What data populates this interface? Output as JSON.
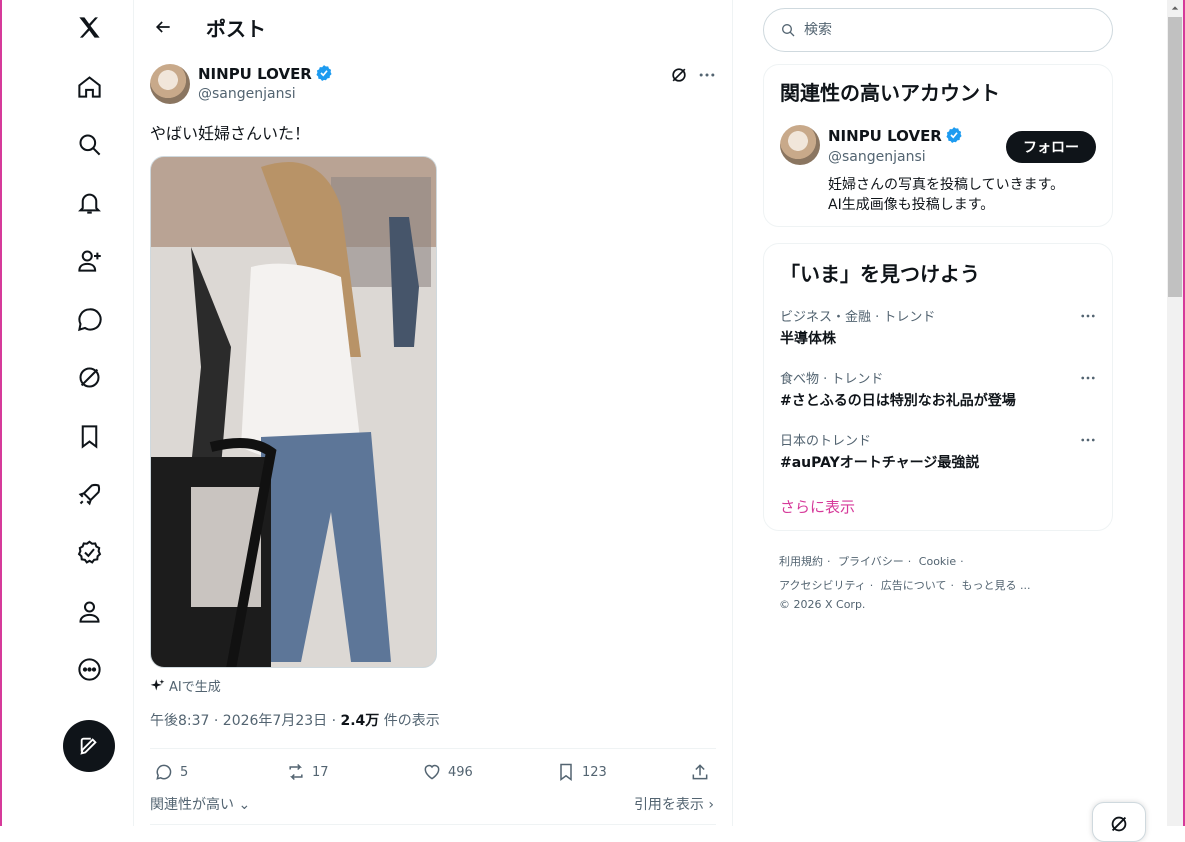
{
  "header": {
    "title": "ポスト"
  },
  "post": {
    "author_name": "NINPU LOVER",
    "author_handle": "@sangenjansi",
    "text": "やばい妊婦さんいた！",
    "ai_label": "AIで生成",
    "timestamp": "午後8:37 · 2026年7月23日 · ",
    "views_count": "2.4万",
    "views_suffix": " 件の表示",
    "replies": "5",
    "reposts": "17",
    "likes": "496",
    "bookmarks": "123",
    "sort_label": "関連性が高い",
    "quotes_label": "引用を表示"
  },
  "search": {
    "placeholder": "検索"
  },
  "related": {
    "title": "関連性の高いアカウント",
    "name": "NINPU LOVER",
    "handle": "@sangenjansi",
    "bio_line1": "妊婦さんの写真を投稿していきます。",
    "bio_line2": "AI生成画像も投稿します。",
    "follow_label": "フォロー"
  },
  "trends": {
    "title": "「いま」を見つけよう",
    "items": [
      {
        "category": "ビジネス・金融 · トレンド",
        "name": "半導体株"
      },
      {
        "category": "食べ物 · トレンド",
        "name": "#さとふるの日は特別なお礼品が登場"
      },
      {
        "category": "日本のトレンド",
        "name": "#auPAYオートチャージ最強説"
      }
    ],
    "show_more": "さらに表示"
  },
  "footer": {
    "terms": "利用規約",
    "privacy": "プライバシー",
    "cookie": "Cookie",
    "accessibility": "アクセシビリティ",
    "ads": "広告について",
    "more": "もっと見る ...",
    "copyright": "© 2026 X Corp."
  },
  "colors": {
    "accent": "#d63a9a",
    "verified": "#1d9bf0",
    "text": "#0f1419",
    "muted": "#536471"
  }
}
